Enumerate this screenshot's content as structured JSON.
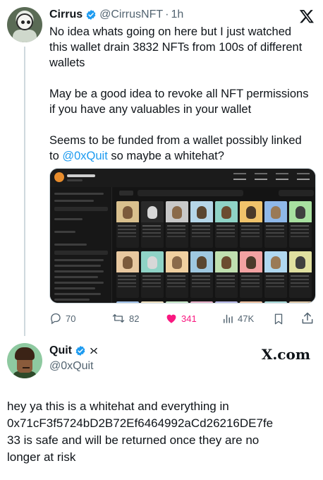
{
  "tweet1": {
    "author_name": "Cirrus",
    "handle": "@CirrusNFT",
    "separator": "·",
    "time": "1h",
    "lines": [
      "No idea whats going on here but I just watched",
      "this wallet drain 3832 NFTs from 100s of different",
      "wallets",
      "",
      "May be a good idea to revoke all NFT permissions",
      "if you have any valuables in your wallet",
      "",
      "Seems to be funded from a wallet possibly linked"
    ],
    "last_line_prefix": "to ",
    "mention": "@0xQuit",
    "last_line_suffix": " so maybe a whitehat?",
    "actions": {
      "replies": "70",
      "retweets": "82",
      "likes": "341",
      "views": "47K"
    }
  },
  "tweet2": {
    "author_name": "Quit",
    "handle": "@0xQuit",
    "xcom_label": "X.com",
    "lines": [
      "hey ya this is a whitehat and everything in",
      "0x71cF3f5724bD2B72Ef6464992aCd26216DE7fe",
      "33 is safe and will be returned once they are no",
      "longer at risk"
    ]
  },
  "colors": {
    "accent": "#1d9bf0",
    "like": "#f91880",
    "muted": "#536471",
    "text": "#0f1419"
  },
  "icons": {
    "verified": "verified-badge-icon",
    "x_logo": "x-logo-icon",
    "reply": "reply-icon",
    "retweet": "retweet-icon",
    "like": "heart-icon",
    "views": "views-icon",
    "bookmark": "bookmark-icon",
    "share": "share-icon"
  }
}
